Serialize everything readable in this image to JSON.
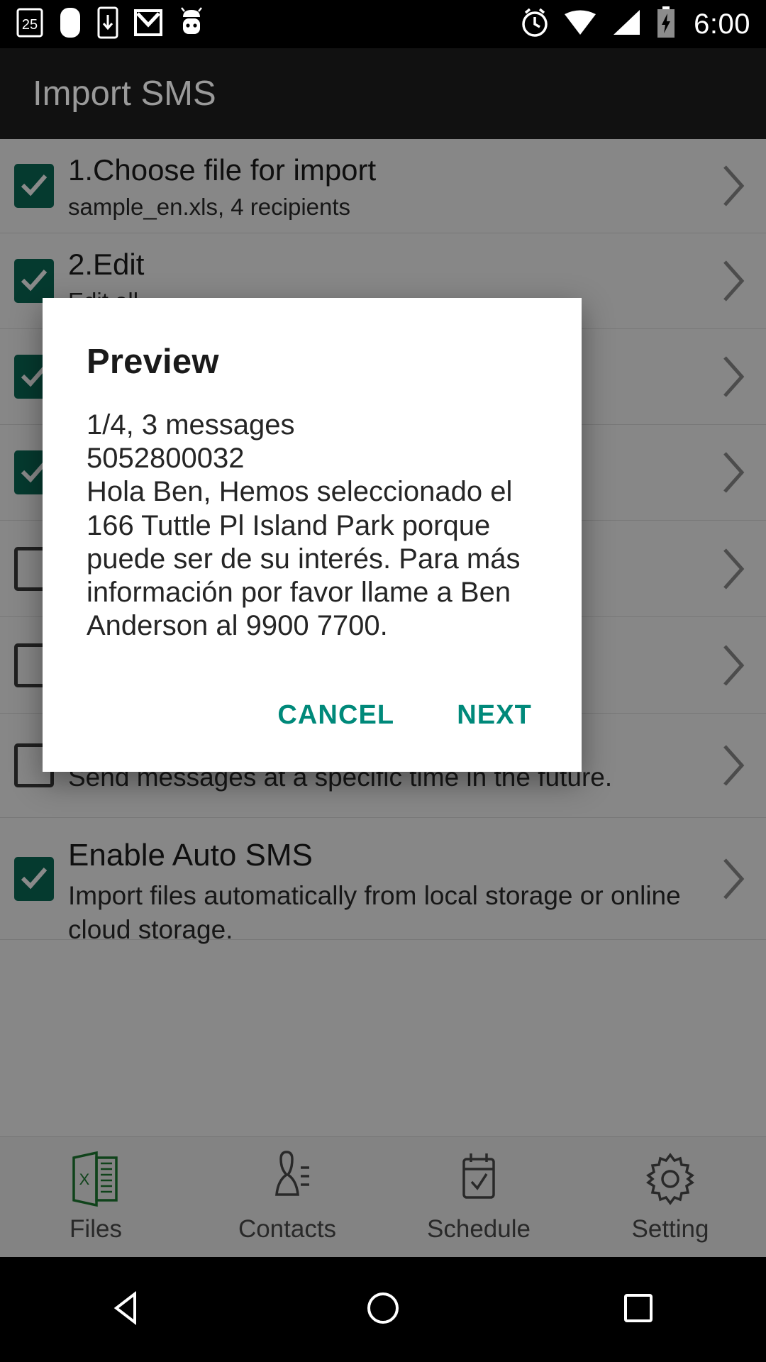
{
  "statusbar": {
    "time": "6:00",
    "left_icons": [
      "calendar-25-icon",
      "app-white-square-icon",
      "download-phone-icon",
      "gmail-icon",
      "android-robot-icon"
    ],
    "right_icons": [
      "alarm-icon",
      "wifi-icon",
      "signal-icon",
      "battery-charging-icon"
    ],
    "calendar_day": "25"
  },
  "appbar": {
    "title": "Import SMS"
  },
  "colors": {
    "accent_teal": "#00897a",
    "checkbox_green": "#0a6b57",
    "appbar_bg": "#111111",
    "excel_green": "#1e7d32"
  },
  "rows": [
    {
      "title": "1.Choose file for import",
      "sub": "sample_en.xls, 4 recipients",
      "checked": true
    },
    {
      "title": "2.Edit",
      "sub": "Edit all",
      "checked": true
    },
    {
      "title": "",
      "sub": "",
      "checked": true
    },
    {
      "title": "",
      "sub": "",
      "checked": true
    },
    {
      "title": "",
      "sub": "",
      "checked": false
    },
    {
      "title": "",
      "sub": "",
      "checked": false
    },
    {
      "title": "",
      "sub": "Send messages at a specific time in the future.",
      "checked": false
    },
    {
      "title": "Enable Auto SMS",
      "sub": "Import files automatically from local storage or online cloud storage.",
      "checked": true
    }
  ],
  "dialog": {
    "title": "Preview",
    "body": "1/4, 3 messages\n5052800032\nHola Ben, Hemos seleccionado el 166 Tuttle Pl Island Park porque puede ser de su interés. Para más información por favor llame a Ben Anderson al 9900 7700.",
    "cancel_label": "CANCEL",
    "next_label": "NEXT"
  },
  "tabbar": {
    "items": [
      {
        "label": "Files",
        "icon": "excel-file-icon"
      },
      {
        "label": "Contacts",
        "icon": "contacts-person-icon"
      },
      {
        "label": "Schedule",
        "icon": "calendar-check-icon"
      },
      {
        "label": "Setting",
        "icon": "gear-icon"
      }
    ]
  },
  "navbar": {
    "items": [
      {
        "name": "back-button",
        "icon": "triangle-back-icon"
      },
      {
        "name": "home-button",
        "icon": "circle-home-icon"
      },
      {
        "name": "recents-button",
        "icon": "square-recents-icon"
      }
    ]
  }
}
